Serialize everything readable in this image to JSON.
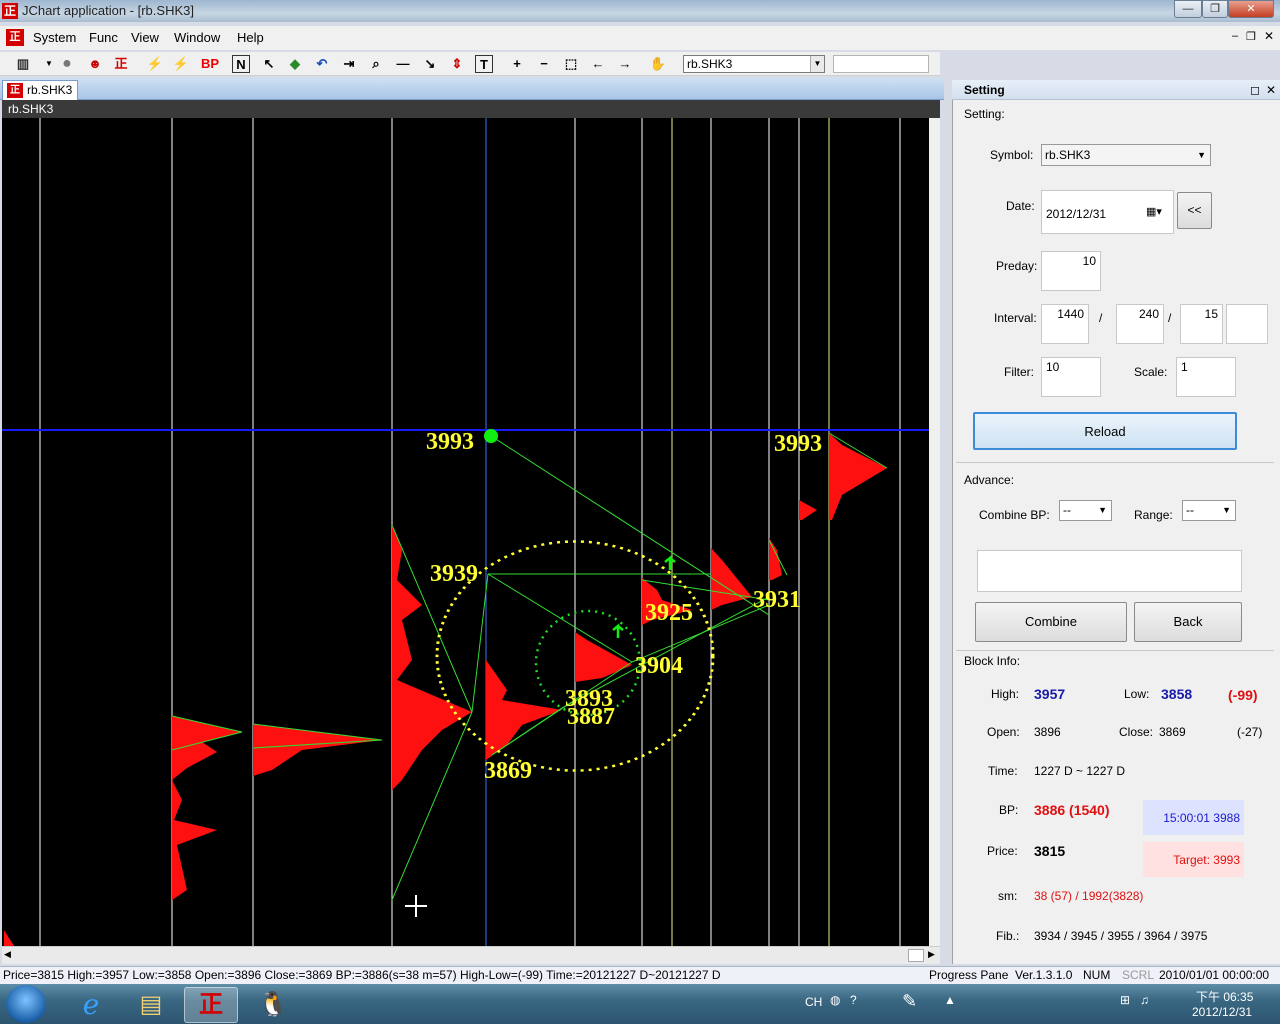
{
  "window": {
    "title": "JChart application - [rb.SHK3]",
    "controls": [
      "—",
      "❐",
      "✕"
    ]
  },
  "menu": [
    "System",
    "Func",
    "View",
    "Window",
    "Help"
  ],
  "toolbar": {
    "symbol": "rb.SHK3",
    "bp_label": "BP",
    "n_label": "N",
    "t_label": "T"
  },
  "doc_tab": "rb.SHK3",
  "chart_data": {
    "symbol": "rb.SHK3",
    "labels": [
      {
        "text": "3993"
      },
      {
        "text": "3993"
      },
      {
        "text": "3939"
      },
      {
        "text": "3925"
      },
      {
        "text": "3931"
      },
      {
        "text": "3904"
      },
      {
        "text": "3893"
      },
      {
        "text": "3887"
      },
      {
        "text": "3869"
      }
    ]
  },
  "panel": {
    "title": "Setting",
    "group_setting": "Setting:",
    "symbol_label": "Symbol:",
    "symbol_value": "rb.SHK3",
    "date_label": "Date:",
    "date_value": "2012/12/31",
    "date_btn": "<<",
    "preday_label": "Preday:",
    "preday_value": "10",
    "interval_label": "Interval:",
    "interval_1": "1440",
    "interval_2": "240",
    "interval_3": "15",
    "sep": "/",
    "filter_label": "Filter:",
    "filter_value": "10",
    "scale_label": "Scale:",
    "scale_value": "1",
    "reload": "Reload",
    "advance": "Advance:",
    "combine_bp_label": "Combine BP:",
    "combine_bp_value": "--",
    "range_label": "Range:",
    "range_value": "--",
    "combine": "Combine",
    "back": "Back",
    "block_info": "Block Info:",
    "high_label": "High:",
    "high_value": "3957",
    "low_label": "Low:",
    "low_value": "3858",
    "hl_diff": "(-99)",
    "open_label": "Open:",
    "open_value": "3896",
    "close_label": "Close:",
    "close_value": "3869",
    "oc_diff": "(-27)",
    "time_label": "Time:",
    "time_value": "1227 D ~ 1227 D",
    "bp_label": "BP:",
    "bp_value": "3886 (1540)",
    "bp_box": "15:00:01  3988",
    "price_label": "Price:",
    "price_value": "3815",
    "target_box": "Target: 3993",
    "sm_label": "sm:",
    "sm_value": "38 (57) / 1992(3828)",
    "fib_label": "Fib.:",
    "fib_value": "3934 / 3945 / 3955 / 3964 / 3975"
  },
  "statusbar": {
    "info": "Price=3815  High:=3957  Low:=3858  Open:=3896  Close:=3869  BP:=3886(s=38 m=57)  High-Low=(-99)  Time:=20121227 D~20121227 D",
    "pane": "Progress Pane",
    "version": "Ver.1.3.1.0",
    "num": "NUM",
    "scrl": "SCRL",
    "datetime": "2010/01/01 00:00:00"
  },
  "taskbar": {
    "lang": "CH",
    "time": "下午 06:35",
    "date": "2012/12/31"
  },
  "colors": {
    "label_yellow": "#ffff33",
    "profile_red": "#ff0000",
    "line_green": "#33dd33",
    "hline_blue": "#1a1aff",
    "high_blue": "#1a1aa8",
    "bp_red": "#e01010"
  }
}
